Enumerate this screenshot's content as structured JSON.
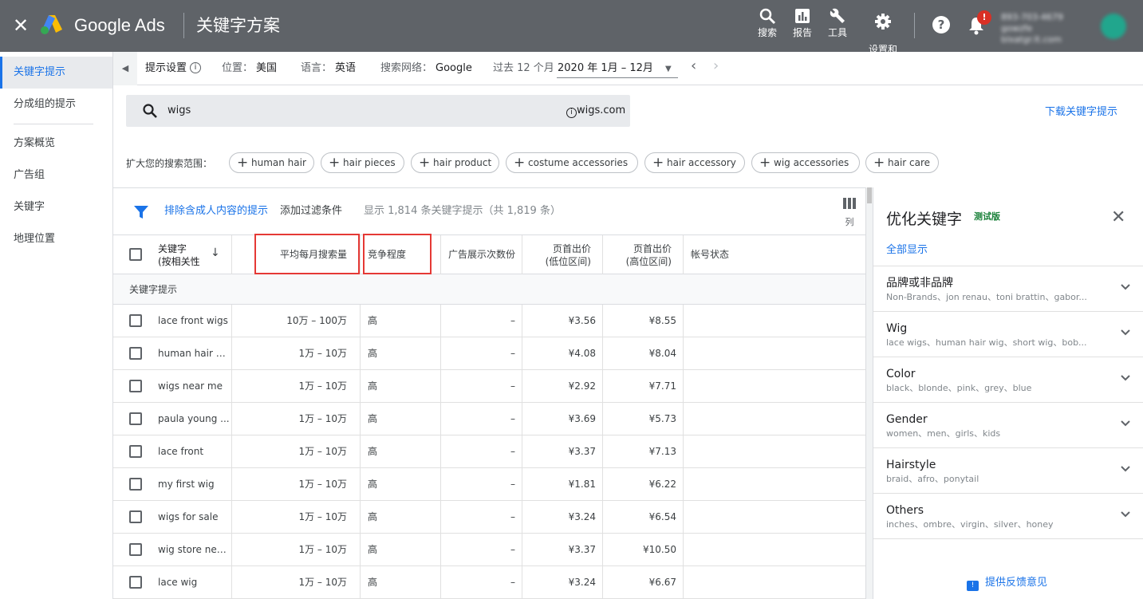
{
  "topbar": {
    "close_glyph": "✕",
    "brand": "Google Ads",
    "title": "关键字方案",
    "tools": [
      {
        "label": "搜索",
        "icon": "search-icon"
      },
      {
        "label": "报告",
        "icon": "report-icon"
      },
      {
        "label": "工具",
        "icon": "wrench-icon"
      },
      {
        "label": "设置和\n结算",
        "icon": "gear-icon"
      }
    ],
    "help_glyph": "?",
    "notification_badge": "!",
    "account_line1": "893-703-4679 gowzfe",
    "account_line2": "blxatgr.lt.com"
  },
  "sidebar": {
    "items": [
      "关键字提示",
      "分成组的提示",
      "方案概览",
      "广告组",
      "关键字",
      "地理位置"
    ]
  },
  "settingsbar": {
    "label": "提示设置",
    "location_label": "位置：",
    "location": "美国",
    "language_label": "语言：",
    "language": "英语",
    "network_label": "搜索网络：",
    "network": "Google",
    "period_label": "过去 12 个月",
    "date_range": "2020 年 1月 – 12月"
  },
  "search": {
    "value": "wigs",
    "site": "wigs.com"
  },
  "download_label": "下载关键字提示",
  "broaden": {
    "label": "扩大您的搜索范围：",
    "chips": [
      "human hair",
      "hair pieces",
      "hair product",
      "costume accessories",
      "hair accessory",
      "wig accessories",
      "hair care"
    ]
  },
  "filters": {
    "exclude_adult": "排除含成人内容的提示",
    "add_filter": "添加过滤条件",
    "count_text": "显示 1,814 条关键字提示（共 1,819 条）",
    "columns_label": "列"
  },
  "table": {
    "headers": {
      "keyword": "关键字\n(按相关性",
      "volume": "平均每月搜索量",
      "competition": "竞争程度",
      "impression_share": "广告展示次数份",
      "bid_low": "页首出价\n(低位区间)",
      "bid_high": "页首出价\n(高位区间)",
      "account_status": "帐号状态"
    },
    "group_label": "关键字提示",
    "rows": [
      {
        "keyword": "lace front wigs",
        "volume": "10万 – 100万",
        "competition": "高",
        "share": "–",
        "low": "¥3.56",
        "high": "¥8.55"
      },
      {
        "keyword": "human hair wi...",
        "volume": "1万 – 10万",
        "competition": "高",
        "share": "–",
        "low": "¥4.08",
        "high": "¥8.04"
      },
      {
        "keyword": "wigs near me",
        "volume": "1万 – 10万",
        "competition": "高",
        "share": "–",
        "low": "¥2.92",
        "high": "¥7.71"
      },
      {
        "keyword": "paula young ...",
        "volume": "1万 – 10万",
        "competition": "高",
        "share": "–",
        "low": "¥3.69",
        "high": "¥5.73"
      },
      {
        "keyword": "lace front",
        "volume": "1万 – 10万",
        "competition": "高",
        "share": "–",
        "low": "¥3.37",
        "high": "¥7.13"
      },
      {
        "keyword": "my first wig",
        "volume": "1万 – 10万",
        "competition": "高",
        "share": "–",
        "low": "¥1.81",
        "high": "¥6.22"
      },
      {
        "keyword": "wigs for sale",
        "volume": "1万 – 10万",
        "competition": "高",
        "share": "–",
        "low": "¥3.24",
        "high": "¥6.54"
      },
      {
        "keyword": "wig store near...",
        "volume": "1万 – 10万",
        "competition": "高",
        "share": "–",
        "low": "¥3.37",
        "high": "¥10.50"
      },
      {
        "keyword": "lace wig",
        "volume": "1万 – 10万",
        "competition": "高",
        "share": "–",
        "low": "¥3.24",
        "high": "¥6.67"
      }
    ]
  },
  "refine": {
    "title": "优化关键字",
    "beta": "测试版",
    "show_all": "全部显示",
    "categories": [
      {
        "name": "品牌或非品牌",
        "sub": "Non-Brands、jon renau、toni brattin、gabor..."
      },
      {
        "name": "Wig",
        "sub": "lace wigs、human hair wig、short wig、bob..."
      },
      {
        "name": "Color",
        "sub": "black、blonde、pink、grey、blue"
      },
      {
        "name": "Gender",
        "sub": "women、men、girls、kids"
      },
      {
        "name": "Hairstyle",
        "sub": "braid、afro、ponytail"
      },
      {
        "name": "Others",
        "sub": "inches、ombre、virgin、silver、honey"
      }
    ],
    "feedback": "提供反馈意见"
  },
  "colors": {
    "topbar": "#5f6368",
    "accent": "#1a73e8",
    "highlight_box": "#e53935",
    "beta": "#188038"
  }
}
